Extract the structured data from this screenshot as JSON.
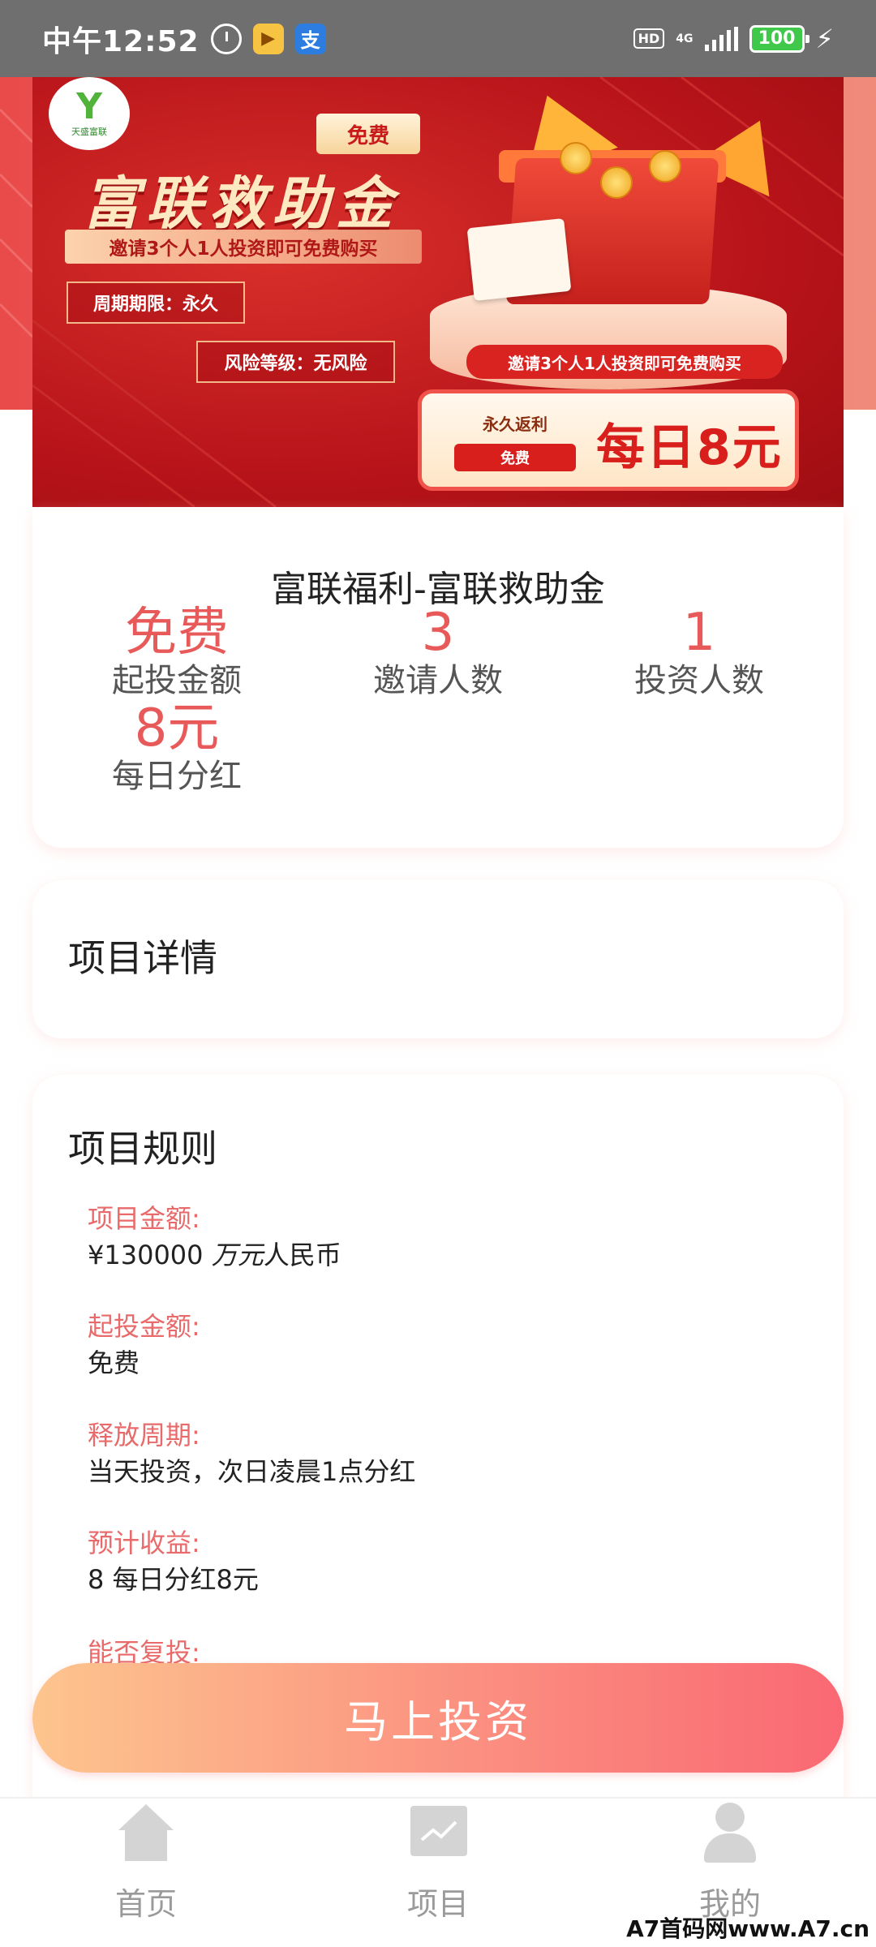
{
  "status_bar": {
    "time": "中午12:52",
    "app1": "▶",
    "app2": "支",
    "hd": "HD",
    "network": "4G",
    "battery": "100",
    "icons": [
      "alarm-icon",
      "app-icon",
      "app-icon",
      "hd-icon",
      "signal-icon",
      "battery-icon",
      "charging-icon"
    ]
  },
  "banner": {
    "logo_text": "天盛富联",
    "free_tag": "免费",
    "title": "富联救助金",
    "subtitle": "邀请3个人1人投资即可免费购买",
    "period": "周期期限：永久",
    "risk": "风险等级：无风险",
    "invite_strip": "邀请3个人1人投资即可免费购买",
    "permanent": "永久返利",
    "free_pill": "免费",
    "daily_amount": "每日8元"
  },
  "product": {
    "title": "富联福利-富联救助金",
    "stats": [
      {
        "value": "免费",
        "label": "起投金额"
      },
      {
        "value": "3",
        "label": "邀请人数"
      },
      {
        "value": "1",
        "label": "投资人数"
      },
      {
        "value": "8元",
        "label": "每日分红"
      }
    ]
  },
  "details": {
    "title": "项目详情"
  },
  "rules": {
    "title": "项目规则",
    "items": [
      {
        "key": "项目金额:",
        "value_prefix": "¥130000 ",
        "value_italic": "万元",
        "value_suffix": "人民币"
      },
      {
        "key": "起投金额:",
        "value": "免费"
      },
      {
        "key": "释放周期:",
        "value": "当天投资，次日凌晨1点分红"
      },
      {
        "key": "预计收益:",
        "value": "8 每日分红8元"
      },
      {
        "key": "能否复投:",
        "value": ""
      }
    ]
  },
  "invest_button": "马上投资",
  "tabs": [
    {
      "label": "首页",
      "icon": "home-icon"
    },
    {
      "label": "项目",
      "icon": "chart-icon"
    },
    {
      "label": "我的",
      "icon": "user-icon"
    }
  ],
  "watermark": "A7首码网www.A7.cn",
  "colors": {
    "accent": "#e85a5a",
    "banner_red": "#b8141a",
    "button_start": "#fdc58e",
    "button_end": "#fa6873"
  }
}
